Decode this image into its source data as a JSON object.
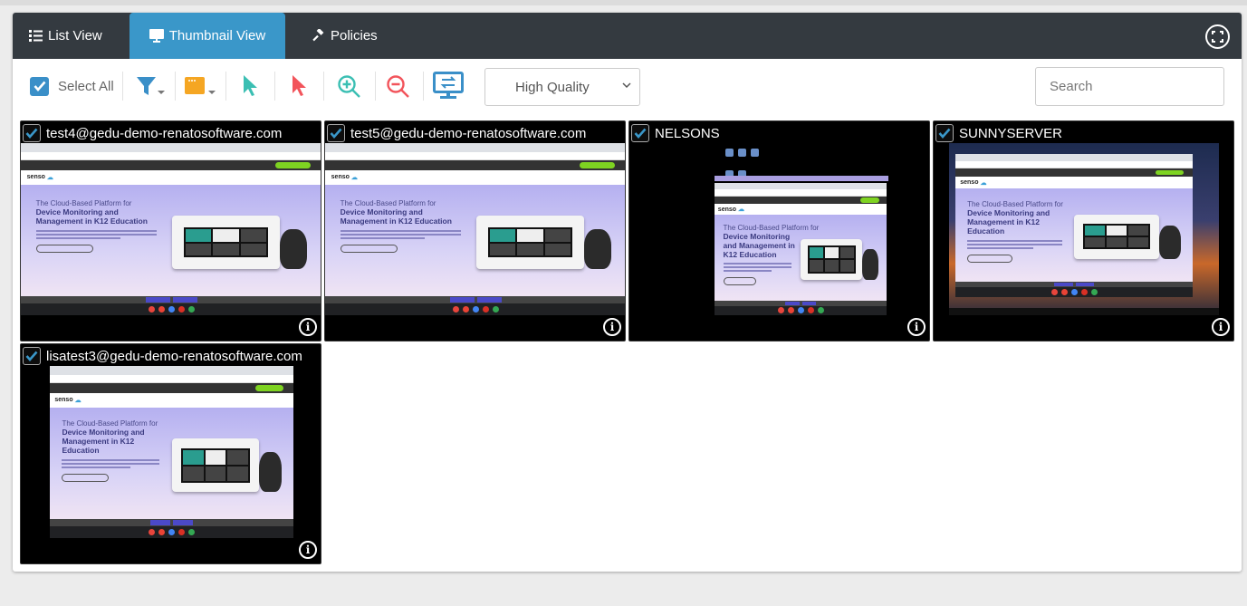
{
  "tabs": [
    {
      "label": "List View",
      "icon": "list-icon"
    },
    {
      "label": "Thumbnail View",
      "icon": "monitor-icon",
      "active": true
    },
    {
      "label": "Policies",
      "icon": "gavel-icon"
    }
  ],
  "toolbar": {
    "select_all_label": "Select All",
    "select_all_checked": true,
    "quality": "High Quality",
    "search_placeholder": "Search"
  },
  "colors": {
    "tabbar": "#343a40",
    "active_tab": "#3a97c9",
    "accent": "#3a8fc8",
    "folder": "#f5a623",
    "pointer_teal": "#3bbfb3",
    "pointer_red": "#f2545b"
  },
  "site": {
    "brand": "senso",
    "headline1": "The Cloud-Based Platform for",
    "headline2": "Device Monitoring and Management in K12 Education"
  },
  "devices": [
    {
      "name": "test4@gedu-demo-renatosoftware.com",
      "checked": true,
      "variant": "full"
    },
    {
      "name": "test5@gedu-demo-renatosoftware.com",
      "checked": true,
      "variant": "full"
    },
    {
      "name": "NELSONS",
      "checked": true,
      "variant": "desktop"
    },
    {
      "name": "SUNNYSERVER",
      "checked": true,
      "variant": "landscape"
    },
    {
      "name": "lisatest3@gedu-demo-renatosoftware.com",
      "checked": true,
      "variant": "pillar"
    }
  ]
}
